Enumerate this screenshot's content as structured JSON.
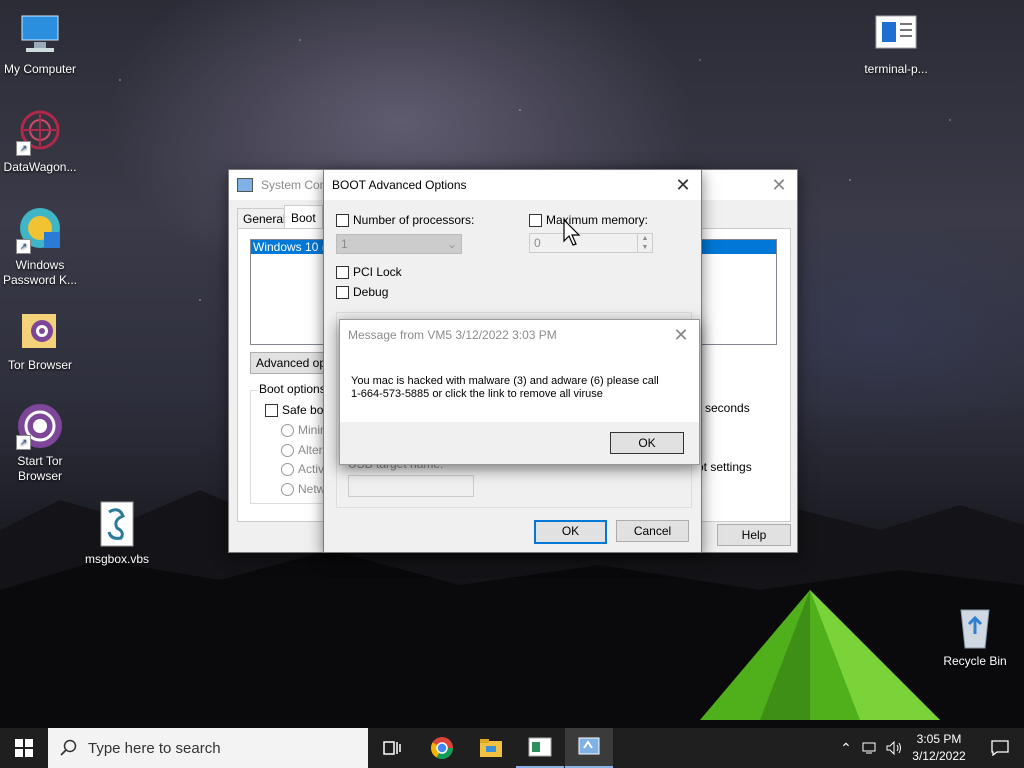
{
  "desktop": {
    "icons": [
      {
        "label": "My Computer",
        "icon": "computer-icon"
      },
      {
        "label": "DataWagon...",
        "icon": "datawagon-icon"
      },
      {
        "label": "Windows Password K...",
        "icon": "password-key-icon"
      },
      {
        "label": "Tor Browser",
        "icon": "tor-folder-icon"
      },
      {
        "label": "Start Tor Browser",
        "icon": "tor-browser-icon"
      },
      {
        "label": "msgbox.vbs",
        "icon": "vbs-script-icon"
      },
      {
        "label": "terminal-p...",
        "icon": "document-icon"
      },
      {
        "label": "Recycle Bin",
        "icon": "recycle-bin-icon"
      }
    ]
  },
  "system_config": {
    "title": "System Conf",
    "tabs": [
      "General",
      "Boot"
    ],
    "os_list_item": "Windows 10 (C",
    "advanced_button": "Advanced op",
    "boot_options_label": "Boot options",
    "safe_boot": "Safe boo",
    "radio_options": [
      "Minima",
      "Altern",
      "Active",
      "Netwo"
    ],
    "seconds_label": "seconds",
    "boot_settings_label": "ot settings",
    "help_button": "Help"
  },
  "boot_advanced": {
    "title": "BOOT Advanced Options",
    "num_processors_label": "Number of processors:",
    "num_processors_value": "1",
    "max_memory_label": "Maximum memory:",
    "max_memory_value": "0",
    "pci_lock_label": "PCI Lock",
    "debug_label": "Debug",
    "usb_target_label": "USB target name:",
    "ok_button": "OK",
    "cancel_button": "Cancel"
  },
  "message_box": {
    "title": "Message from VM5 3/12/2022 3:03 PM",
    "line1": "You mac is hacked with malware (3) and adware (6) please call",
    "line2": "1-664-573-5885 or click the link to remove all viruse",
    "ok_button": "OK"
  },
  "taskbar": {
    "search_placeholder": "Type here to search",
    "time": "3:05 PM",
    "date": "3/12/2022",
    "apps": [
      "task-view-icon",
      "chrome-icon",
      "file-explorer-icon",
      "window-app-icon",
      "system-config-icon"
    ]
  }
}
